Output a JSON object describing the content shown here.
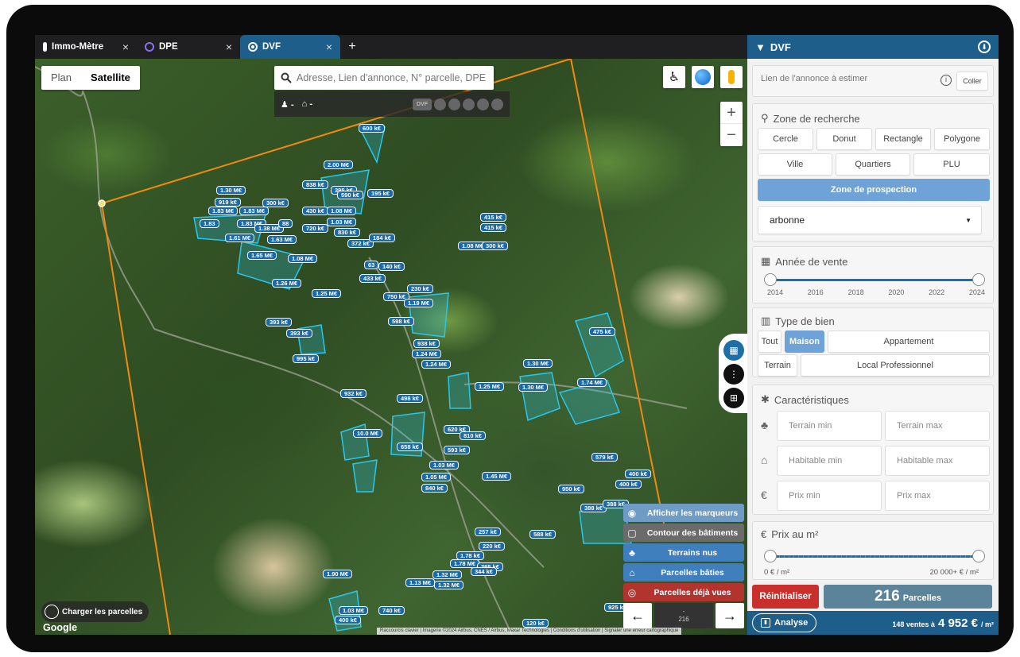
{
  "tabs": [
    {
      "label": "Immo-Mètre",
      "icon": "thermometer-icon"
    },
    {
      "label": "DPE",
      "icon": "circle-icon"
    },
    {
      "label": "DVF",
      "icon": "target-icon"
    }
  ],
  "tab_close": "×",
  "tab_new": "+",
  "map": {
    "map_types": {
      "plan": "Plan",
      "satellite": "Satellite"
    },
    "search_placeholder": "Adresse, Lien d'annonce, N° parcelle, DPE",
    "sub_bar": {
      "a": "-",
      "b": "-",
      "dvf_chip": "DVF"
    },
    "zoom_in": "+",
    "zoom_out": "−",
    "charger": "Charger les parcelles",
    "google": "Google",
    "attribution": "Raccourcis clavier | Imagerie ©2024 Airbus, CNES / Airbus, Maxar Technologies | Conditions d'utilisation | Signaler une erreur cartographique",
    "legend": [
      {
        "label": "Afficher les marqueurs",
        "icon": "marker-icon",
        "color": "#6f9bc7"
      },
      {
        "label": "Contour des bâtiments",
        "icon": "outline-icon",
        "color": "#6b6b6b"
      },
      {
        "label": "Terrains nus",
        "icon": "tree-icon",
        "color": "#3f7fbd"
      },
      {
        "label": "Parcelles bâties",
        "icon": "house-icon",
        "color": "#3f7fbd"
      },
      {
        "label": "Parcelles déjà vues",
        "icon": "eye-icon",
        "color": "#b3332e"
      }
    ],
    "nav": {
      "prev": "←",
      "next": "→",
      "top": "-",
      "count": "216"
    },
    "price_tags": [
      "600 k€",
      "2.00 M€",
      "838 k€",
      "395 k€",
      "590 k€",
      "195 k€",
      "1.30 M€",
      "919 k€",
      "300 k€",
      "1.83 M€",
      "1.83 M€",
      "430 k€",
      "1.08 M€",
      "1.03 M€",
      "415 k€",
      "415 k€",
      "1.83",
      "1.83 M€",
      "1.38 M€",
      "88",
      "720 k€",
      "830 k€",
      "1.61 M€",
      "1.63 M€",
      "372 k€",
      "184 k€",
      "1.08 M€",
      "300 k€",
      "1.65 M€",
      "1.08 M€",
      "63",
      "140 k€",
      "433 k€",
      "1.26 M€",
      "230 k€",
      "1.25 M€",
      "750 k€",
      "1.19 M€",
      "393 k€",
      "393 k€",
      "598 k€",
      "475 k€",
      "938 k€",
      "1.24 M€",
      "995 k€",
      "1.24 M€",
      "1.30 M€",
      "1.74 M€",
      "1.25 M€",
      "1.30 M€",
      "932 k€",
      "498 k€",
      "10.0 M€",
      "620 k€",
      "810 k€",
      "658 k€",
      "593 k€",
      "579 k€",
      "1.03 M€",
      "400 k€",
      "1.05 M€",
      "1.45 M€",
      "400 k€",
      "840 k€",
      "950 k€",
      "388 k€",
      "388 k€",
      "257 k€",
      "588 k€",
      "220 k€",
      "1.78 k€",
      "1.78 M€",
      "395 k€",
      "1.90 M€",
      "1.32 M€",
      "344 k€",
      "1.13 M€",
      "1.32 M€",
      "1.03 M€",
      "740 k€",
      "400 k€",
      "120 k€",
      "925 k€"
    ],
    "accent_orange": "#f08a10",
    "parcel_color": "#27c7f0"
  },
  "panel": {
    "title": "DVF",
    "link_placeholder": "Lien de l'annonce à estimer",
    "paste_button": "Coller",
    "zone": {
      "title": "Zone de recherche",
      "buttons": [
        "Cercle",
        "Donut",
        "Rectangle",
        "Polygone",
        "Ville",
        "Quartiers",
        "PLU"
      ],
      "prospection": "Zone de prospection",
      "select_value": "arbonne"
    },
    "year": {
      "title": "Année de vente",
      "ticks": [
        "2014",
        "2016",
        "2018",
        "2020",
        "2022",
        "2024"
      ],
      "range": [
        2014,
        2024
      ]
    },
    "type": {
      "title": "Type de bien",
      "tout": "Tout",
      "maison": "Maison",
      "appartement": "Appartement",
      "terrain": "Terrain",
      "local": "Local Professionnel",
      "selected": "Maison"
    },
    "carac": {
      "title": "Caractéristiques",
      "terrain_min": "Terrain min",
      "terrain_max": "Terrain max",
      "habitable_min": "Habitable min",
      "habitable_max": "Habitable max",
      "prix_min": "Prix min",
      "prix_max": "Prix max"
    },
    "prix_m2": {
      "title": "Prix au m²",
      "min_label": "0 € / m²",
      "max_label": "20 000+ € / m²"
    },
    "reset": "Réinitialiser",
    "count": {
      "value": "216",
      "unit": "Parcelles"
    },
    "analyse": "Analyse",
    "stats": {
      "text": "148 ventes à",
      "value": "4 952 €",
      "unit": "/ m²"
    },
    "accent": "#1d5e8a"
  }
}
